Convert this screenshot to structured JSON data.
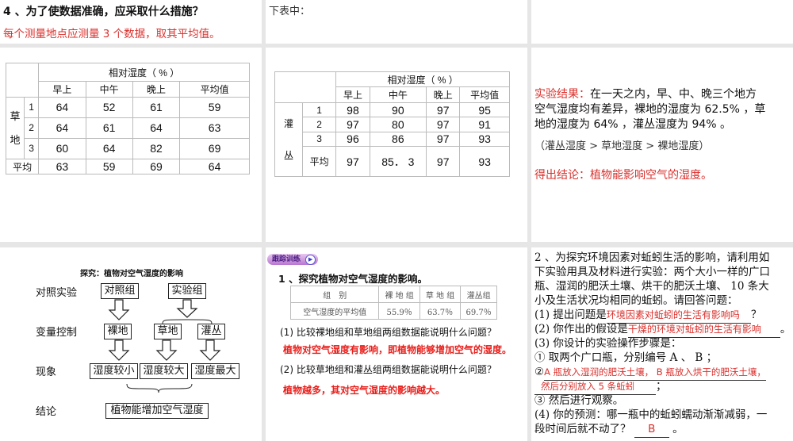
{
  "p1": {
    "question": "4 、为了使数据准确，应采取什么措施？",
    "answer": "每个测量地点应测量 3 个数据，取其平均值。"
  },
  "p2": {
    "text": "下表中："
  },
  "grass_table": {
    "header": "相对湿度（ % ）",
    "cols": [
      "早上",
      "中午",
      "晚上",
      "平均值"
    ],
    "group": [
      "草",
      "地"
    ],
    "rows": [
      {
        "label": "1",
        "values": [
          "64",
          "52",
          "61",
          "59"
        ]
      },
      {
        "label": "2",
        "values": [
          "64",
          "61",
          "64",
          "63"
        ]
      },
      {
        "label": "3",
        "values": [
          "60",
          "64",
          "82",
          "69"
        ]
      },
      {
        "label": "平均",
        "values": [
          "63",
          "59",
          "69",
          "64"
        ]
      }
    ]
  },
  "shrub_table": {
    "header": "相对湿度（ % ）",
    "cols": [
      "早上",
      "中午",
      "晚上",
      "平均值"
    ],
    "group": [
      "灌",
      "丛"
    ],
    "rows": [
      {
        "label": "1",
        "values": [
          "98",
          "90",
          "97",
          "95"
        ]
      },
      {
        "label": "2",
        "values": [
          "97",
          "80",
          "97",
          "91"
        ]
      },
      {
        "label": "3",
        "values": [
          "96",
          "86",
          "97",
          "93"
        ]
      },
      {
        "label": "平均",
        "values": [
          "97",
          "85． 3",
          "97",
          "93"
        ]
      }
    ]
  },
  "result": {
    "label": "实验结果：",
    "text1": "在一天之内，早、中、晚三个地方",
    "text2": "空气湿度均有差异，裸地的湿度为 62.5% ，草",
    "text3": "地的湿度为 64% ，灌丛湿度为 94% 。",
    "compare": "（灌丛湿度 > 草地湿度 > 裸地湿度）",
    "conclusion": "得出结论：植物能影响空气的湿度。"
  },
  "flow": {
    "title": "探究：植物对空气湿度的影响",
    "rows": [
      "对照实验",
      "变量控制",
      "现象",
      "结论"
    ],
    "control": "对照组",
    "experiment": "实验组",
    "bare": "裸地",
    "grass": "草地",
    "shrub": "灌丛",
    "low": "湿度较小",
    "mid": "湿度较大",
    "high": "湿度最大",
    "conclusion": "植物能增加空气湿度"
  },
  "practice": {
    "badge": "跟踪训练",
    "q1": "1 、探究植物对空气湿度的影响。",
    "table": {
      "head": [
        "组　别",
        "裸 地 组",
        "草 地 组",
        "灌丛组"
      ],
      "row": [
        "空气湿度的平均值",
        "55.9％",
        "63.7％",
        "69.7％"
      ]
    },
    "s1": "(1) 比较裸地组和草地组两组数据能说明什么问题？",
    "a1": "植物对空气湿度有影响，即植物能够增加空气的湿度。",
    "s2": "(2) 比较草地组和灌丛组两组数据能说明什么问题？",
    "a2": "植物越多，其对空气湿度的影响越大。"
  },
  "q2": {
    "l1": "2 、为探究环境因素对蚯蚓生活的影响，请利用如",
    "l2": "下实验用具及材料进行实验：两个大小一样的广口",
    "l3": "瓶、湿润的肥沃土壤、烘干的肥沃土壤、 10 条大",
    "l4": "小及生活状况均相同的蚯蚓。请回答问题：",
    "p1": "(1) 提出问题是",
    "a1": "环境因素对蚯蚓的生活有影响吗",
    "e1": "？",
    "p2": "(2) 你作出的假设是",
    "a2": "干燥的环境对蚯蚓的生活有影响",
    "e2": "。",
    "p3": "(3) 你设计的实验操作步骤是：",
    "s1": "① 取两个广口瓶，分别编号 A 、 B ；",
    "s2p": "②",
    "s2a": "A 瓶放入湿润的肥沃土壤， B 瓶放入烘干的肥沃土壤，",
    "s2b": "然后分别放入 5 条蚯蚓",
    "s2e": "；",
    "s3": "③ 然后进行观察。",
    "p4": "(4) 你的预测：哪一瓶中的蚯蚓蠕动渐渐减弱，一",
    "p4b": "段时间后就不动了？",
    "a4": "B",
    "e4": "。"
  }
}
